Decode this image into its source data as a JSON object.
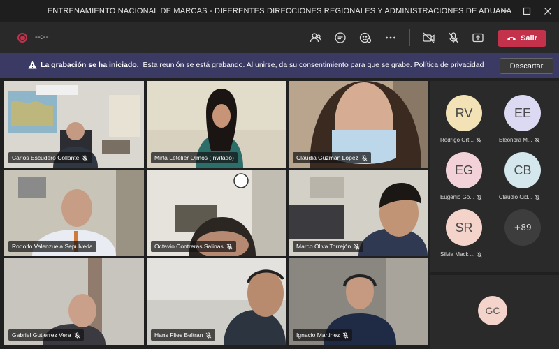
{
  "window": {
    "title": "ENTRENAMIENTO NACIONAL DE MARCAS - DIFERENTES DIRECCIONES REGIONALES Y ADMINISTRACIONES DE ADUANA"
  },
  "toolbar": {
    "timer": "--:--",
    "leave_label": "Salir",
    "colors": {
      "leave": "#c4314b",
      "record": "#c4314b"
    }
  },
  "banner": {
    "bold_text": "La grabación se ha iniciado.",
    "text": "Esta reunión se está grabando. Al unirse, da su consentimiento para que se grabe.",
    "link_text": "Política de privacidad",
    "dismiss_label": "Descartar",
    "color": "#3b3a65"
  },
  "videos": [
    {
      "name": "Carlos Escudero Collante"
    },
    {
      "name": "Mirta Letelier Olmos (Invitado)",
      "active": true
    },
    {
      "name": "Claudia Guzman Lopez"
    },
    {
      "name": "Rodolfo Valenzuela Sepulveda",
      "active": true
    },
    {
      "name": "Octavio Contreras Salinas"
    },
    {
      "name": "Marco Oliva Torrejón"
    },
    {
      "name": "Gabriel Gutierrez Vera"
    },
    {
      "name": "Hans Flies Beltran"
    },
    {
      "name": "Ignacio Martinez"
    }
  ],
  "roster": [
    {
      "initials": "RV",
      "name": "Rodrigo Ort...",
      "color": "#f2e2b6"
    },
    {
      "initials": "EE",
      "name": "Eleonora M...",
      "color": "#dcd9f2"
    },
    {
      "initials": "EG",
      "name": "Eugenio Go...",
      "color": "#f2d2d8"
    },
    {
      "initials": "CB",
      "name": "Claudio Cid...",
      "color": "#d3e7ec"
    },
    {
      "initials": "SR",
      "name": "Silvia Mack ...",
      "color": "#f4d3cb"
    }
  ],
  "overflow_count": "+89",
  "self": {
    "initials": "GC"
  }
}
